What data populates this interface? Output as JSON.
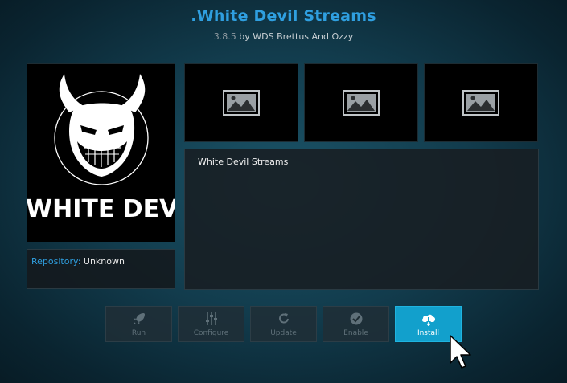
{
  "header": {
    "title": ".White Devil Streams",
    "version": "3.8.5",
    "by_text": " by WDS Brettus And Ozzy"
  },
  "addon_icon": {
    "logo_text": "WHITE DEVIL"
  },
  "repository": {
    "label": "Repository:",
    "value": "Unknown"
  },
  "screenshots": [
    "image-placeholder-icon",
    "image-placeholder-icon",
    "image-placeholder-icon"
  ],
  "description": {
    "text": "White Devil Streams"
  },
  "buttons": [
    {
      "label": "Run",
      "icon": "rocket-icon",
      "enabled": false
    },
    {
      "label": "Configure",
      "icon": "sliders-icon",
      "enabled": false
    },
    {
      "label": "Update",
      "icon": "refresh-icon",
      "enabled": false
    },
    {
      "label": "Enable",
      "icon": "check-circle-icon",
      "enabled": false
    },
    {
      "label": "Install",
      "icon": "cloud-download-icon",
      "enabled": true
    }
  ],
  "colors": {
    "accent": "#2f9fe0",
    "active_button": "#12a0cc",
    "disabled_text": "#5f7079"
  }
}
